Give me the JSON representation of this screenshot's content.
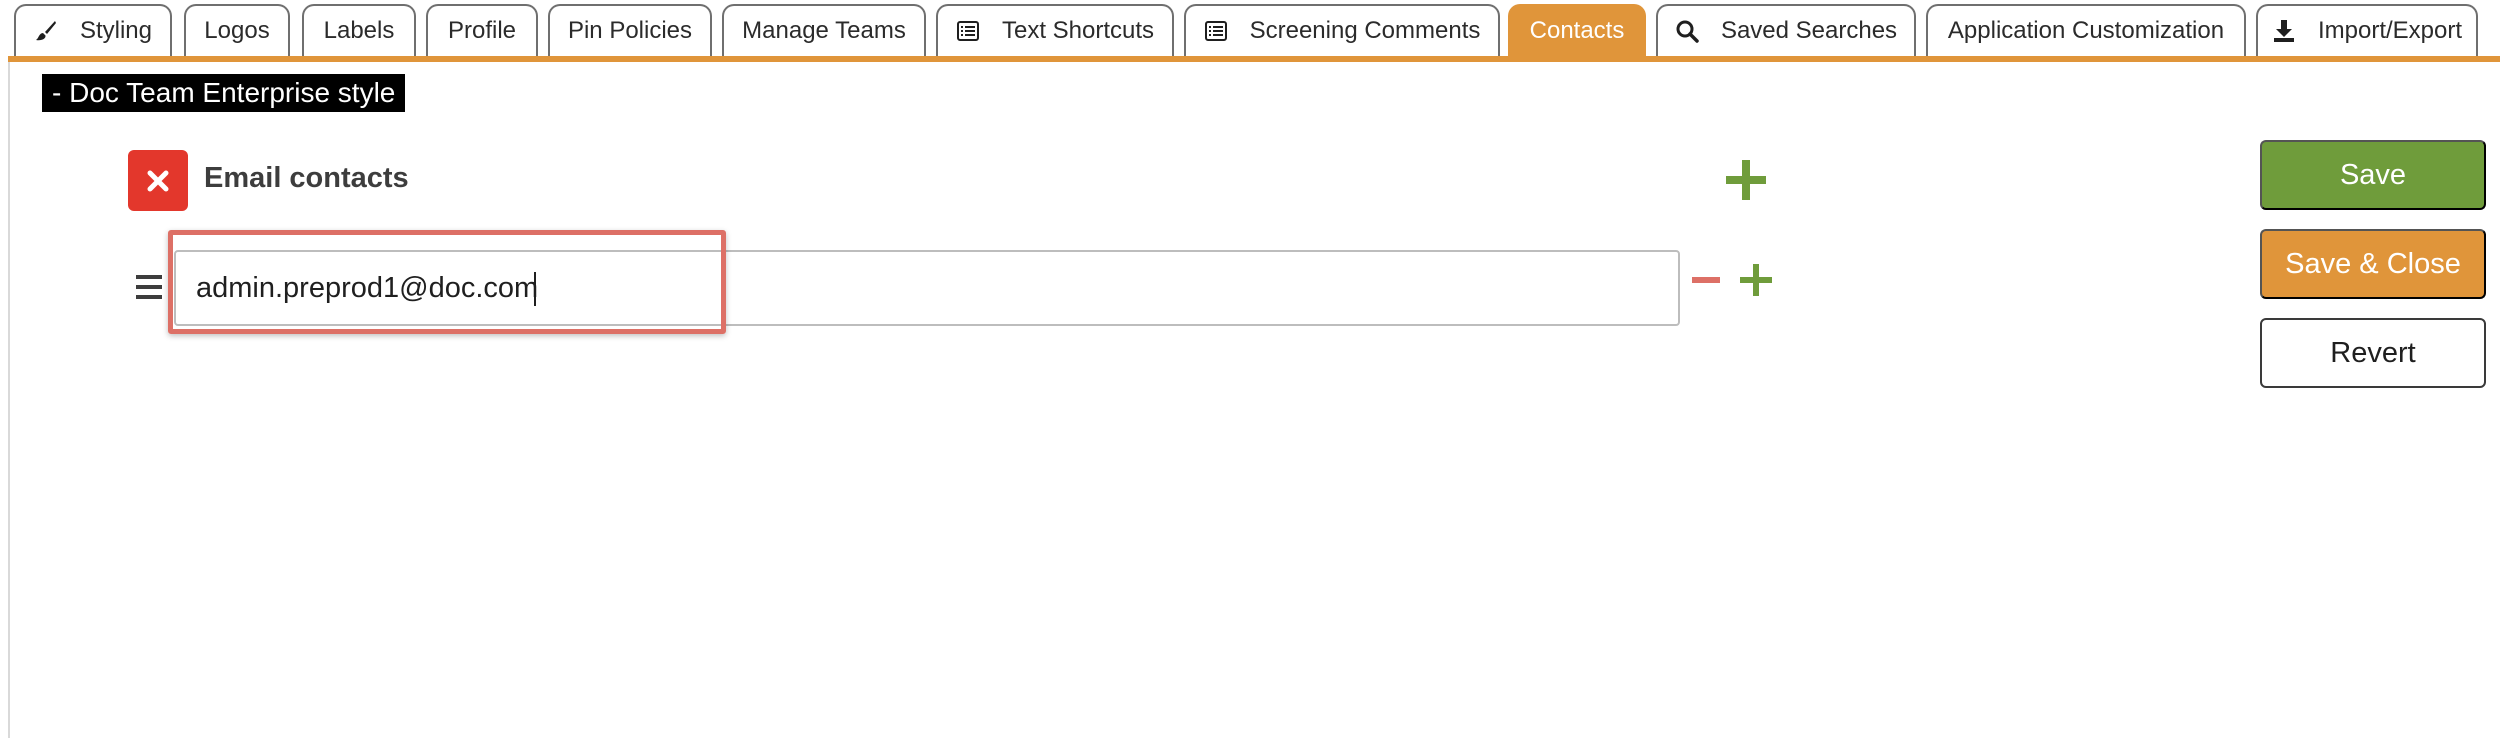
{
  "tabs": [
    {
      "label": "Styling",
      "icon": "paintbrush-icon",
      "active": false
    },
    {
      "label": "Logos",
      "icon": "",
      "active": false
    },
    {
      "label": "Labels",
      "icon": "",
      "active": false
    },
    {
      "label": "Profile",
      "icon": "",
      "active": false
    },
    {
      "label": "Pin Policies",
      "icon": "",
      "active": false
    },
    {
      "label": "Manage Teams",
      "icon": "",
      "active": false
    },
    {
      "label": "Text Shortcuts",
      "icon": "list-icon",
      "active": false
    },
    {
      "label": "Screening Comments",
      "icon": "list-icon",
      "active": false
    },
    {
      "label": "Contacts",
      "icon": "",
      "active": true
    },
    {
      "label": "Saved Searches",
      "icon": "search-icon",
      "active": false
    },
    {
      "label": "Application Customization",
      "icon": "",
      "active": false
    },
    {
      "label": "Import/Export",
      "icon": "download-icon",
      "active": false
    }
  ],
  "page": {
    "style_title": "- Doc Team Enterprise style"
  },
  "contacts": {
    "section_label": "Email contacts",
    "email_value": "admin.preprod1@doc.com"
  },
  "actions": {
    "save": "Save",
    "save_close": "Save & Close",
    "revert": "Revert"
  },
  "colors": {
    "accent_orange": "#e0953a",
    "save_green": "#6f9c3b",
    "remove_red": "#e3372c",
    "highlight_red": "#dd7066"
  }
}
